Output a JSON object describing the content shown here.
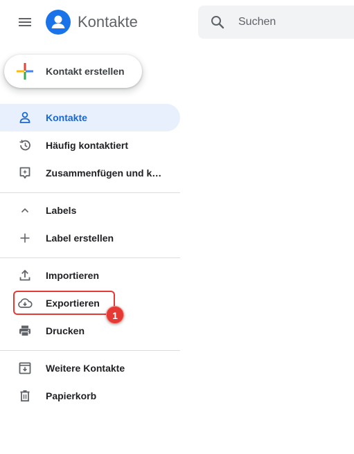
{
  "header": {
    "app_title": "Kontakte",
    "menu_icon": "menu-icon",
    "logo_icon": "contacts-logo-icon",
    "logo_color": "#1a73e8"
  },
  "search": {
    "placeholder": "Suchen",
    "value": ""
  },
  "create_button": {
    "label": "Kontakt erstellen",
    "icon": "multicolor-plus-icon"
  },
  "nav": {
    "items": [
      {
        "label": "Kontakte",
        "icon": "person-icon",
        "active": true
      },
      {
        "label": "Häufig kontaktiert",
        "icon": "history-icon"
      },
      {
        "label": "Zusammenfügen und k…",
        "icon": "merge-icon"
      }
    ]
  },
  "labels": {
    "heading": "Labels",
    "create_label": "Label erstellen"
  },
  "actions": {
    "items": [
      {
        "label": "Importieren",
        "icon": "upload-icon"
      },
      {
        "label": "Exportieren",
        "icon": "cloud-download-icon"
      },
      {
        "label": "Drucken",
        "icon": "print-icon"
      }
    ]
  },
  "other": {
    "items": [
      {
        "label": "Weitere Kontakte",
        "icon": "archive-icon"
      },
      {
        "label": "Papierkorb",
        "icon": "trash-icon"
      }
    ]
  },
  "annotation": {
    "step_number": "1",
    "color": "#e53935"
  },
  "colors": {
    "accent": "#1967d2",
    "active_bg": "#e8f0fe",
    "icon_gray": "#5f6368"
  }
}
